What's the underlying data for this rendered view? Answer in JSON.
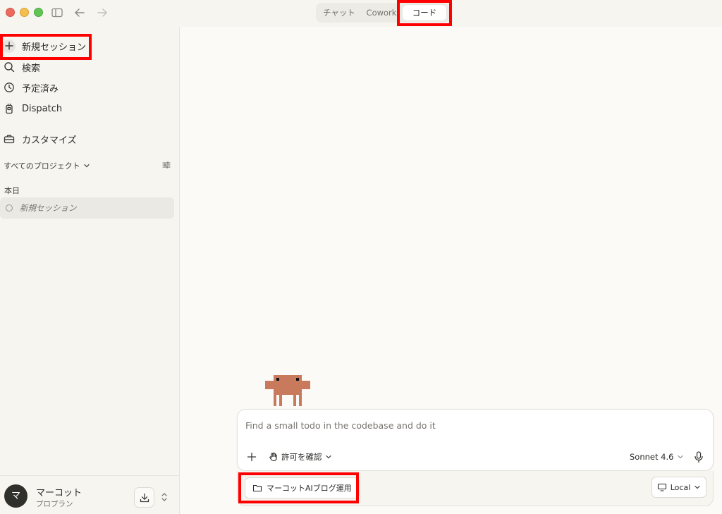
{
  "window": {
    "tabs": [
      {
        "label": "チャット",
        "selected": false
      },
      {
        "label": "Cowork",
        "selected": false
      },
      {
        "label": "コード",
        "selected": true
      }
    ]
  },
  "sidebar": {
    "items": [
      {
        "label": "新規セッション",
        "icon": "plus-icon"
      },
      {
        "label": "検索",
        "icon": "search-icon"
      },
      {
        "label": "予定済み",
        "icon": "clock-icon"
      },
      {
        "label": "Dispatch",
        "icon": "dispatch-icon"
      },
      {
        "label": "カスタマイズ",
        "icon": "toolbox-icon"
      }
    ],
    "project_filter": "すべてのプロジェクト",
    "group_label": "本日",
    "sessions": [
      {
        "label": "新規セッション"
      }
    ],
    "user": {
      "avatar_initial": "マ",
      "name": "マーコット",
      "plan": "プロプラン"
    }
  },
  "composer": {
    "placeholder": "Find a small todo in the codebase and do it",
    "permission_label": "許可を確認",
    "model_label": "Sonnet 4.6",
    "folder_label": "マーコットAIブログ運用",
    "environment_label": "Local"
  },
  "colors": {
    "highlight": "#ff0000",
    "mascot": "#c97a5d",
    "background": "#fbfaf7"
  }
}
